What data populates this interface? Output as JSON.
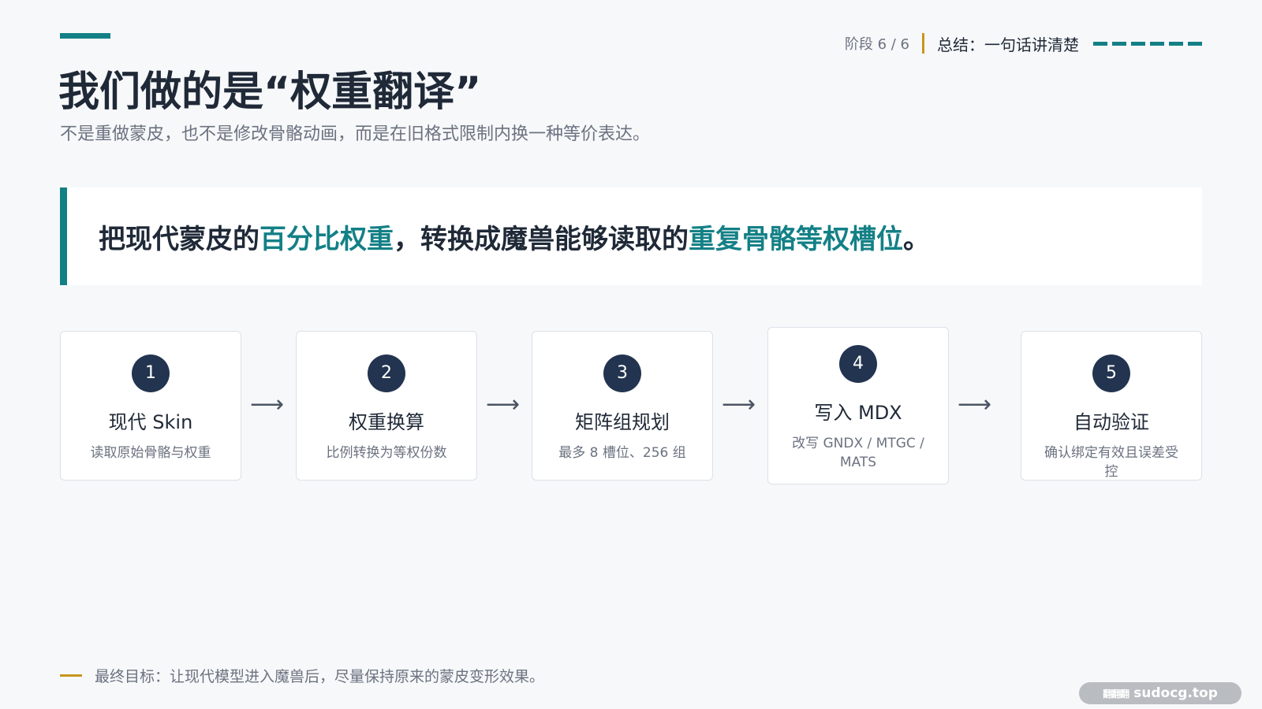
{
  "header": {
    "stage_num": "阶段 6 / 6",
    "stage_label": "总结：一句话讲清楚",
    "title": "我们做的是“权重翻译”",
    "subtitle": "不是重做蒙皮，也不是修改骨骼动画，而是在旧格式限制内换一种等价表达。"
  },
  "quote": {
    "part1": "把现代蒙皮的",
    "hl1": "百分比权重",
    "part2": "，转换成魔兽能够读取的",
    "hl2": "重复骨骼等权槽位",
    "part3": "。"
  },
  "steps": [
    {
      "number": "1",
      "name": "现代 Skin",
      "desc": "读取原始骨骼与权重"
    },
    {
      "number": "2",
      "name": "权重换算",
      "desc": "比例转换为等权份数"
    },
    {
      "number": "3",
      "name": "矩阵组规划",
      "desc": "最多 8 槽位、256 组"
    },
    {
      "number": "4",
      "name": "写入 MDX",
      "desc": "改写 GNDX / MTGC / MATS"
    },
    {
      "number": "5",
      "name": "自动验证",
      "desc": "确认绑定有效且误差受控"
    }
  ],
  "arrow": "⟶",
  "footer": {
    "text": "最终目标：让现代模型进入魔兽后，尽量保持原来的蒙皮变形效果。"
  },
  "watermark": {
    "logo": "翻翻翻",
    "text": "sudocg.top"
  },
  "colors": {
    "accent": "#138086",
    "gold": "#c8951f",
    "badge": "#22344f"
  }
}
